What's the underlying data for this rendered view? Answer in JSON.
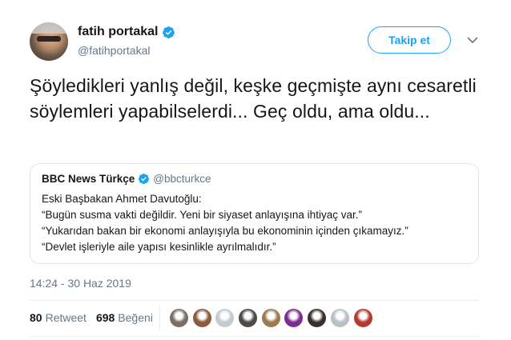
{
  "author": {
    "display_name": "fatih portakal",
    "handle": "@fatihportakal"
  },
  "follow_label": "Takip et",
  "tweet_text": "Şöyledikleri yanlış değil, keşke geçmişte aynı cesaretli söylemleri yapabilselerdi... Geç oldu, ama oldu...",
  "quoted": {
    "name": "BBC News Türkçe",
    "handle": "@bbcturkce",
    "lines": [
      "Eski Başbakan Ahmet Davutoğlu:",
      "“Bugün susma vakti değildir. Yeni bir siyaset anlayışına ihtiyaç var.”",
      "“Yukarıdan bakan bir ekonomi anlayışıyla bu ekonominin içinden çıkamayız.”",
      "“Devlet işleriyle aile yapısı kesinlikle ayrılmalıdır.”"
    ]
  },
  "timestamp": "14:24 - 30 Haz 2019",
  "stats": {
    "retweet_count": "80",
    "retweet_label": "Retweet",
    "like_count": "698",
    "like_label": "Beğeni"
  },
  "colors": {
    "accent": "#1da1f2",
    "secondary_text": "#657786",
    "border": "#e1e8ed"
  },
  "liker_avatars": [
    {
      "icon": "liker-avatar",
      "color": "#7a6f66"
    },
    {
      "icon": "liker-avatar",
      "color": "#8c5a3c"
    },
    {
      "icon": "liker-avatar",
      "color": "#c3cad1"
    },
    {
      "icon": "liker-avatar",
      "color": "#4d4a48"
    },
    {
      "icon": "liker-avatar",
      "color": "#9a7a4e"
    },
    {
      "icon": "liker-avatar",
      "color": "#7b2d8f"
    },
    {
      "icon": "liker-avatar",
      "color": "#3a2f2b"
    },
    {
      "icon": "liker-avatar",
      "color": "#b9c0c7"
    },
    {
      "icon": "liker-avatar",
      "color": "#b23a2e"
    }
  ]
}
